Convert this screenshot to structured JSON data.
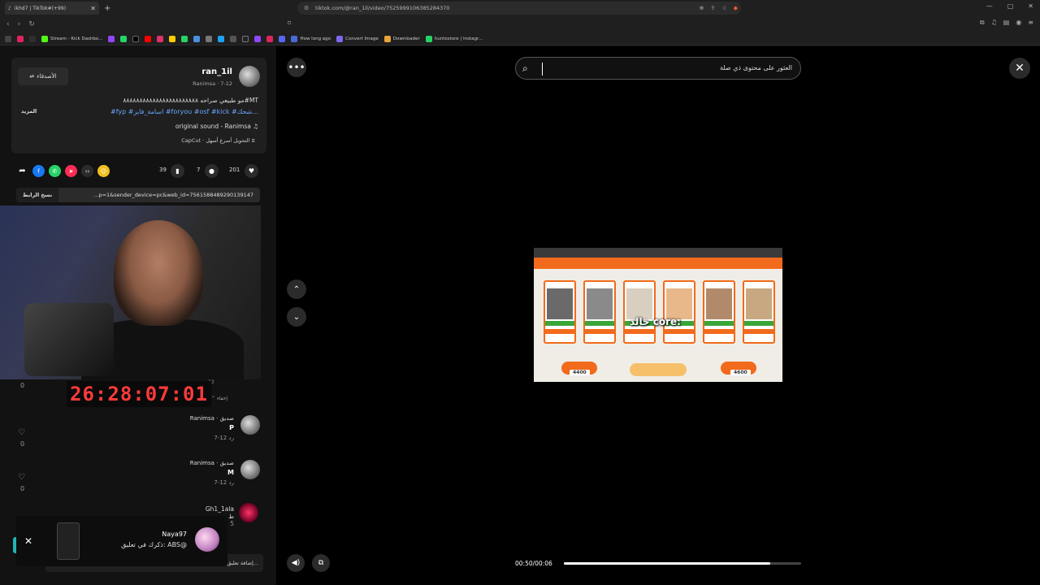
{
  "browser": {
    "tab_title": "ikhd7 | TikTok#(+99)",
    "url": "tiktok.com/@ran_1il/video/7525999106385284370",
    "bookmarks": [
      "Stream - Kick Dashbo...",
      "How long ago",
      "Convert Image",
      "Downloader",
      "huntostore | Instagr..."
    ]
  },
  "post": {
    "friends_label": "الأصدقاء",
    "username": "ran_1il",
    "subline": "Ranimsa · 7-12",
    "caption_line1": "مو طبيعي صراحه ٨٨٨٨٨٨٨٨٨٨٨٨٨٨٨٨٨٨٨٨٨٨٨#MT",
    "caption_line2": "#fyp #اسامة_فايز #foryou #osf #kick #شحك...",
    "more_label": "المزيد",
    "sound": "original sound - Ranimsa",
    "capcut": "CapCut · التحويل أسرع أسهل",
    "likes": "201",
    "comments_count": "7",
    "saves": "39",
    "copy_label": "نسخ الرابط",
    "share_link": "...p=1&sender_device=pc&web_id=7561588489290139147"
  },
  "stream": {
    "timer": "26:28:07:01",
    "hide_label": "إخفاء",
    "small_count": "23",
    "zero": "0"
  },
  "comments": [
    {
      "name": "Ranimsa · صديق",
      "text": "P",
      "date": "7-12  رد",
      "likes": "0"
    },
    {
      "name": "Ranimsa · صديق",
      "text": "M",
      "date": "7-12  رد",
      "likes": "0"
    }
  ],
  "last_comment": {
    "name": "Gh1_1ala",
    "text": "ط",
    "date": "5"
  },
  "notification": {
    "name": "Naya97",
    "text": "ذكرك في تعليق: ABS@"
  },
  "add_comment_placeholder": "إضافة تعليق...",
  "player": {
    "search_placeholder": "العثور على محتوى ذي صلة",
    "subtitle": "خالد core:",
    "time": "00:50/00:06",
    "progress": 0.87,
    "score_left": "4400",
    "score_right": "4600"
  }
}
